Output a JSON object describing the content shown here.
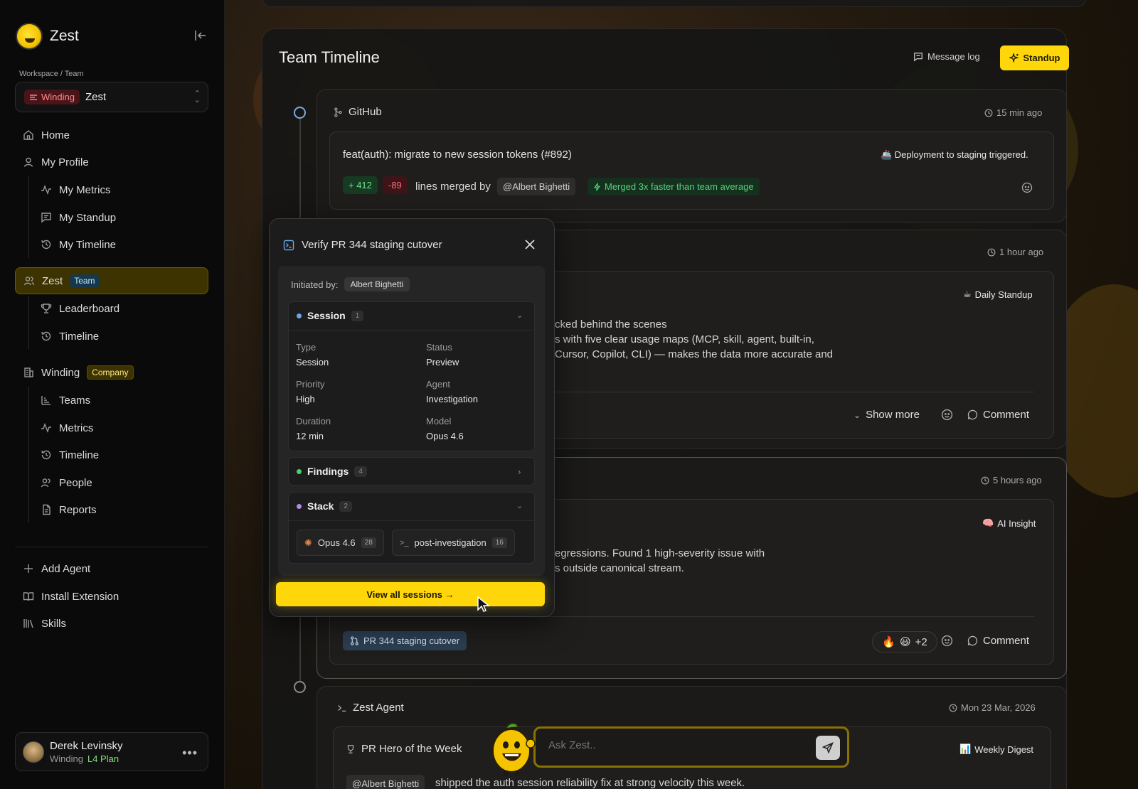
{
  "app": {
    "name": "Zest"
  },
  "workspace": {
    "label": "Workspace / Team",
    "badge": "Winding",
    "name": "Zest"
  },
  "nav": {
    "home": "Home",
    "my_profile": "My Profile",
    "my_metrics": "My Metrics",
    "my_standup": "My Standup",
    "my_timeline": "My Timeline",
    "team": "Zest",
    "team_tag": "Team",
    "leaderboard": "Leaderboard",
    "team_timeline": "Timeline",
    "company": "Winding",
    "company_tag": "Company",
    "teams": "Teams",
    "metrics": "Metrics",
    "company_timeline": "Timeline",
    "people": "People",
    "reports": "Reports",
    "add_agent": "Add Agent",
    "install_extension": "Install Extension",
    "skills": "Skills"
  },
  "user": {
    "name": "Derek Levinsky",
    "org": "Winding",
    "plan": "L4 Plan"
  },
  "header": {
    "title": "Team Timeline",
    "message_log": "Message log",
    "standup": "Standup"
  },
  "events": {
    "github": {
      "source": "GitHub",
      "time": "15 min ago",
      "title": "feat(auth): migrate to new session tokens (#892)",
      "deploy": "🚢 Deployment to staging triggered.",
      "added": "+ 412",
      "removed": "-89",
      "merged_by": "lines merged by",
      "author": "@Albert Bighetti",
      "speed": "Merged 3x faster than team average"
    },
    "standup": {
      "time": "1 hour ago",
      "tag": "Daily Standup",
      "line1": "cked behind the scenes",
      "line2": "s with five clear usage maps (MCP, skill, agent, built-in,",
      "line3": "Cursor, Copilot, CLI) — makes the data more accurate and",
      "show_more": "Show more",
      "comment": "Comment"
    },
    "insight": {
      "time": "5 hours ago",
      "tag": "AI Insight",
      "line1": "egressions. Found 1 high-severity issue with",
      "line2": "s outside canonical stream.",
      "pr": "PR 344 staging cutover",
      "reactions_more": "+2",
      "comment": "Comment"
    },
    "agent": {
      "source": "Zest Agent",
      "time": "Mon 23 Mar, 2026",
      "title": "PR Hero of the Week",
      "tag": "Weekly Digest",
      "author": "@Albert Bighetti",
      "text": "shipped the auth session reliability fix at strong velocity this week."
    }
  },
  "ask": {
    "placeholder": "Ask Zest.."
  },
  "popup": {
    "title": "Verify PR 344 staging cutover",
    "initiated_label": "Initiated by:",
    "initiated_by": "Albert Bighetti",
    "session": {
      "label": "Session",
      "count": "1",
      "type_k": "Type",
      "type_v": "Session",
      "status_k": "Status",
      "status_v": "Preview",
      "priority_k": "Priority",
      "priority_v": "High",
      "agent_k": "Agent",
      "agent_v": "Investigation",
      "duration_k": "Duration",
      "duration_v": "12 min",
      "model_k": "Model",
      "model_v": "Opus 4.6"
    },
    "findings": {
      "label": "Findings",
      "count": "4"
    },
    "stack": {
      "label": "Stack",
      "count": "2",
      "item1": "Opus 4.6",
      "item1_count": "28",
      "item2": "post-investigation",
      "item2_count": "16"
    },
    "view_all": "View all sessions →"
  },
  "colors": {
    "accent": "#ffd60a",
    "team_tag": "#17384a",
    "success": "#6fe28b",
    "danger": "#ff6c76"
  }
}
